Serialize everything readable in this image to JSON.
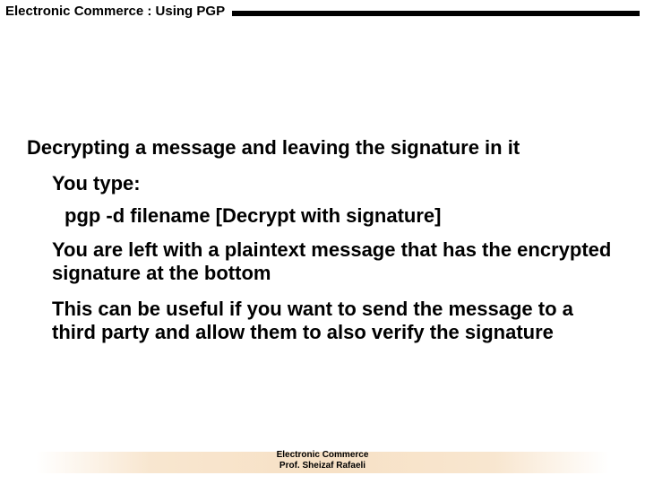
{
  "header": {
    "title": "Electronic Commerce :  Using PGP"
  },
  "body": {
    "heading": "Decrypting a message and leaving the signature in it",
    "you_type": "You type:",
    "command": "pgp -d filename  [Decrypt with signature]",
    "para1": "You are left with a plaintext message that has the encrypted signature at the bottom",
    "para2": "This can be useful if you want to send the message to a third party and allow them to also verify the signature"
  },
  "footer": {
    "line1": "Electronic Commerce",
    "line2": "Prof. Sheizaf Rafaeli"
  }
}
